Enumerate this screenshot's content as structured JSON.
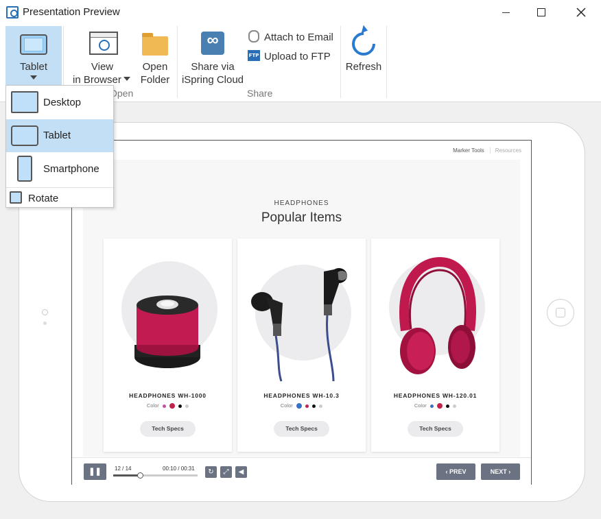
{
  "window": {
    "title": "Presentation Preview"
  },
  "ribbon": {
    "tablet": "Tablet",
    "view_browser_line1": "View",
    "view_browser_line2": "in Browser",
    "open_folder_line1": "Open",
    "open_folder_line2": "Folder",
    "open_group": "Open",
    "share_line1": "Share via",
    "share_line2": "iSpring Cloud",
    "attach_email": "Attach to Email",
    "upload_ftp": "Upload to FTP",
    "ftp_badge": "FTP",
    "share_group": "Share",
    "refresh": "Refresh"
  },
  "device_menu": {
    "items": [
      {
        "label": "Desktop",
        "icon": "desktop-icon",
        "selected": false
      },
      {
        "label": "Tablet",
        "icon": "tablet-icon",
        "selected": true
      },
      {
        "label": "Smartphone",
        "icon": "smartphone-icon",
        "selected": false
      }
    ],
    "rotate": "Rotate"
  },
  "slide": {
    "topbar": {
      "marker_tools": "Marker Tools",
      "resources": "Resources"
    },
    "kicker": "HEADPHONES",
    "heading": "Popular Items",
    "products": [
      {
        "name": "HEADPHONES WH-1000",
        "color_label": "Color",
        "button": "Tech Specs",
        "image": "red-speaker",
        "swatches": [
          "#c24fa8",
          "#c2204d",
          "#111111",
          "#cccccc"
        ],
        "selected_swatch": 1
      },
      {
        "name": "HEADPHONES WH-10.3",
        "color_label": "Color",
        "button": "Tech Specs",
        "image": "black-earbuds",
        "swatches": [
          "#3a6fc9",
          "#c2204d",
          "#111111",
          "#cccccc"
        ],
        "selected_swatch": 0
      },
      {
        "name": "HEADPHONES WH-120.01",
        "color_label": "Color",
        "button": "Tech Specs",
        "image": "red-headphones",
        "swatches": [
          "#3a6fc9",
          "#c2204d",
          "#111111",
          "#cccccc"
        ],
        "selected_swatch": 1
      }
    ]
  },
  "player": {
    "counter": "12 / 14",
    "time": "00:10 / 00:31",
    "progress": 0.32,
    "prev": "PREV",
    "next": "NEXT"
  }
}
